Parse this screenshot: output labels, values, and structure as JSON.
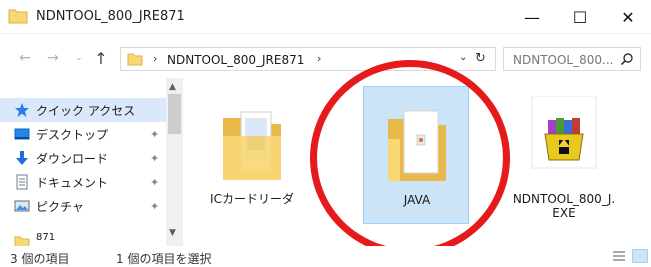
{
  "window": {
    "title": "NDNTOOL_800_JRE871",
    "minimize_glyph": "—",
    "maximize_glyph": "☐",
    "close_glyph": "✕"
  },
  "address_bar": {
    "path": "NDNTOOL_800_JRE871",
    "separator": "›",
    "dropdown_glyph": "⌄",
    "refresh_glyph": "↻"
  },
  "nav": {
    "back_glyph": "←",
    "forward_glyph": "→",
    "recent_glyph": "⌄",
    "up_glyph": "↑"
  },
  "search": {
    "placeholder": "NDNTOOL_800..."
  },
  "sidebar": {
    "items": [
      {
        "label": "クイック アクセス",
        "icon": "star-icon",
        "pinned": false
      },
      {
        "label": "デスクトップ",
        "icon": "desktop-icon",
        "pinned": true
      },
      {
        "label": "ダウンロード",
        "icon": "download-arrow-icon",
        "pinned": true
      },
      {
        "label": "ドキュメント",
        "icon": "document-icon",
        "pinned": true
      },
      {
        "label": "ピクチャ",
        "icon": "pictures-icon",
        "pinned": true
      },
      {
        "label": "871",
        "icon": "folder-icon",
        "pinned": false
      }
    ],
    "pin_glyph": "📌"
  },
  "files": [
    {
      "name": "ICカードリーダ",
      "type": "folder",
      "selected": false
    },
    {
      "name": "JAVA",
      "type": "folder",
      "selected": true
    },
    {
      "name": "NDNTOOL_800_J.\nEXE",
      "type": "exe",
      "selected": false
    }
  ],
  "status": {
    "count": "3 個の項目",
    "selection": "1 個の項目を選択"
  },
  "colors": {
    "selection_bg": "#cce4f7",
    "selection_border": "#99d1ff",
    "annotation_red": "#e61a1a",
    "folder_yellow": "#f8d775"
  }
}
